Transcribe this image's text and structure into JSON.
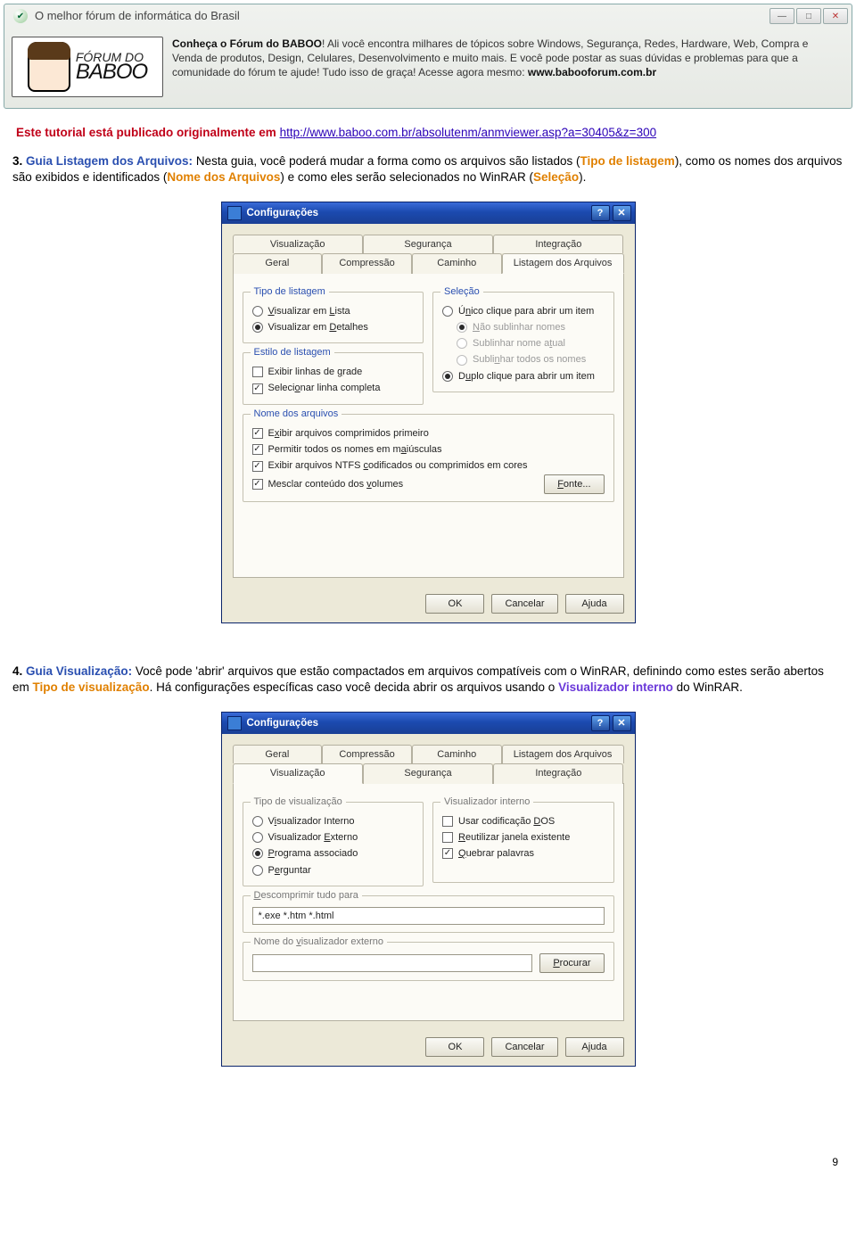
{
  "browser": {
    "title": "O melhor fórum de informática do Brasil",
    "logo_line1": "FÓRUM DO",
    "logo_line2": "BABOO",
    "promo": "Conheça o Fórum do BABOO! Ali você encontra milhares de tópicos sobre Windows, Segurança, Redes, Hardware, Web, Compra e Venda de produtos, Design, Celulares, Desenvolvimento e muito mais. E você pode postar as suas dúvidas e problemas para que a comunidade do fórum te ajude! Tudo isso de graça! Acesse agora mesmo: ",
    "promo_bold": "www.babooforum.com.br"
  },
  "doc": {
    "intro": "Este tutorial está publicado originalmente em ",
    "intro_link": "http://www.baboo.com.br/absolutenm/anmviewer.asp?a=30405&z=300",
    "p3_num": "3. ",
    "p3_title": "Guia Listagem dos Arquivos:",
    "p3_a": " Nesta guia, você poderá mudar a forma como os arquivos são listados (",
    "p3_b": "Tipo de listagem",
    "p3_c": "), como os nomes dos arquivos são exibidos e identificados (",
    "p3_d": "Nome dos Arquivos",
    "p3_e": ") e como eles serão selecionados no WinRAR (",
    "p3_f": "Seleção",
    "p3_g": ").",
    "p4_num": "4. ",
    "p4_title": "Guia Visualização:",
    "p4_a": " Você pode 'abrir' arquivos que estão compactados em arquivos compatíveis com o WinRAR, definindo como estes serão abertos em ",
    "p4_b": "Tipo de visualização",
    "p4_c": ". Há configurações específicas caso você decida abrir os arquivos usando o ",
    "p4_d": "Visualizador interno",
    "p4_e": " do WinRAR."
  },
  "dlg1": {
    "title": "Configurações",
    "tabs_row1": [
      "Visualização",
      "Segurança",
      "Integração"
    ],
    "tabs_row2": [
      "Geral",
      "Compressão",
      "Caminho",
      "Listagem dos Arquivos"
    ],
    "groups": {
      "tipo_listagem": {
        "legend": "Tipo de listagem",
        "r1": "Visualizar em Lista",
        "r2": "Visualizar em Detalhes"
      },
      "estilo_listagem": {
        "legend": "Estilo de listagem",
        "c1": "Exibir linhas de grade",
        "c2": "Selecionar linha completa"
      },
      "selecao": {
        "legend": "Seleção",
        "r1": "Único clique para abrir um item",
        "r2": "Não sublinhar nomes",
        "r3": "Sublinhar nome atual",
        "r4": "Sublinhar todos os nomes",
        "r5": "Duplo clique para abrir um item"
      },
      "nome_arquivos": {
        "legend": "Nome dos arquivos",
        "c1": "Exibir arquivos comprimidos primeiro",
        "c2": "Permitir todos os nomes em maiúsculas",
        "c3": "Exibir arquivos NTFS codificados ou comprimidos em cores",
        "c4": "Mesclar conteúdo dos volumes"
      },
      "fonte_btn": "Fonte..."
    },
    "btns": {
      "ok": "OK",
      "cancel": "Cancelar",
      "help": "Ajuda"
    }
  },
  "dlg2": {
    "title": "Configurações",
    "tabs_row1": [
      "Geral",
      "Compressão",
      "Caminho",
      "Listagem dos Arquivos"
    ],
    "tabs_row2": [
      "Visualização",
      "Segurança",
      "Integração"
    ],
    "groups": {
      "tipo_vis": {
        "legend": "Tipo de visualização",
        "r1": "Visualizador Interno",
        "r2": "Visualizador Externo",
        "r3": "Programa associado",
        "r4": "Perguntar"
      },
      "vis_interno": {
        "legend": "Visualizador interno",
        "c1": "Usar codificação DOS",
        "c2": "Reutilizar janela existente",
        "c3": "Quebrar palavras"
      },
      "descomp": {
        "legend": "Descomprimir tudo para",
        "value": "*.exe *.htm *.html"
      },
      "viewer_ext": {
        "legend": "Nome do visualizador externo",
        "btn": "Procurar"
      }
    },
    "btns": {
      "ok": "OK",
      "cancel": "Cancelar",
      "help": "Ajuda"
    }
  },
  "page_number": "9"
}
